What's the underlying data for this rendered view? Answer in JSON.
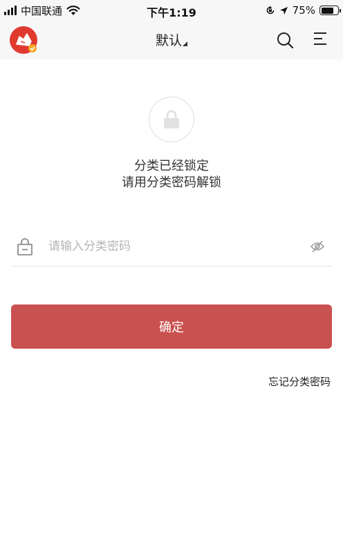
{
  "status_bar": {
    "carrier": "中国联通",
    "time": "下午1:19",
    "battery_percent": "75%",
    "battery_level": 0.75,
    "icons": [
      "signal-icon",
      "wifi-icon",
      "orientation-lock-icon",
      "location-icon",
      "battery-icon"
    ]
  },
  "nav": {
    "title": "默认",
    "icons": [
      "avatar",
      "search-icon",
      "menu-icon"
    ]
  },
  "lock_screen": {
    "message_line1": "分类已经锁定",
    "message_line2": "请用分类密码解锁"
  },
  "password": {
    "placeholder": "请输入分类密码",
    "value": ""
  },
  "actions": {
    "confirm_label": "确定",
    "forgot_label": "忘记分类密码"
  },
  "colors": {
    "accent": "#c9514f",
    "avatar_bg": "#e03a2f",
    "bar_bg": "#f7f7f7"
  }
}
